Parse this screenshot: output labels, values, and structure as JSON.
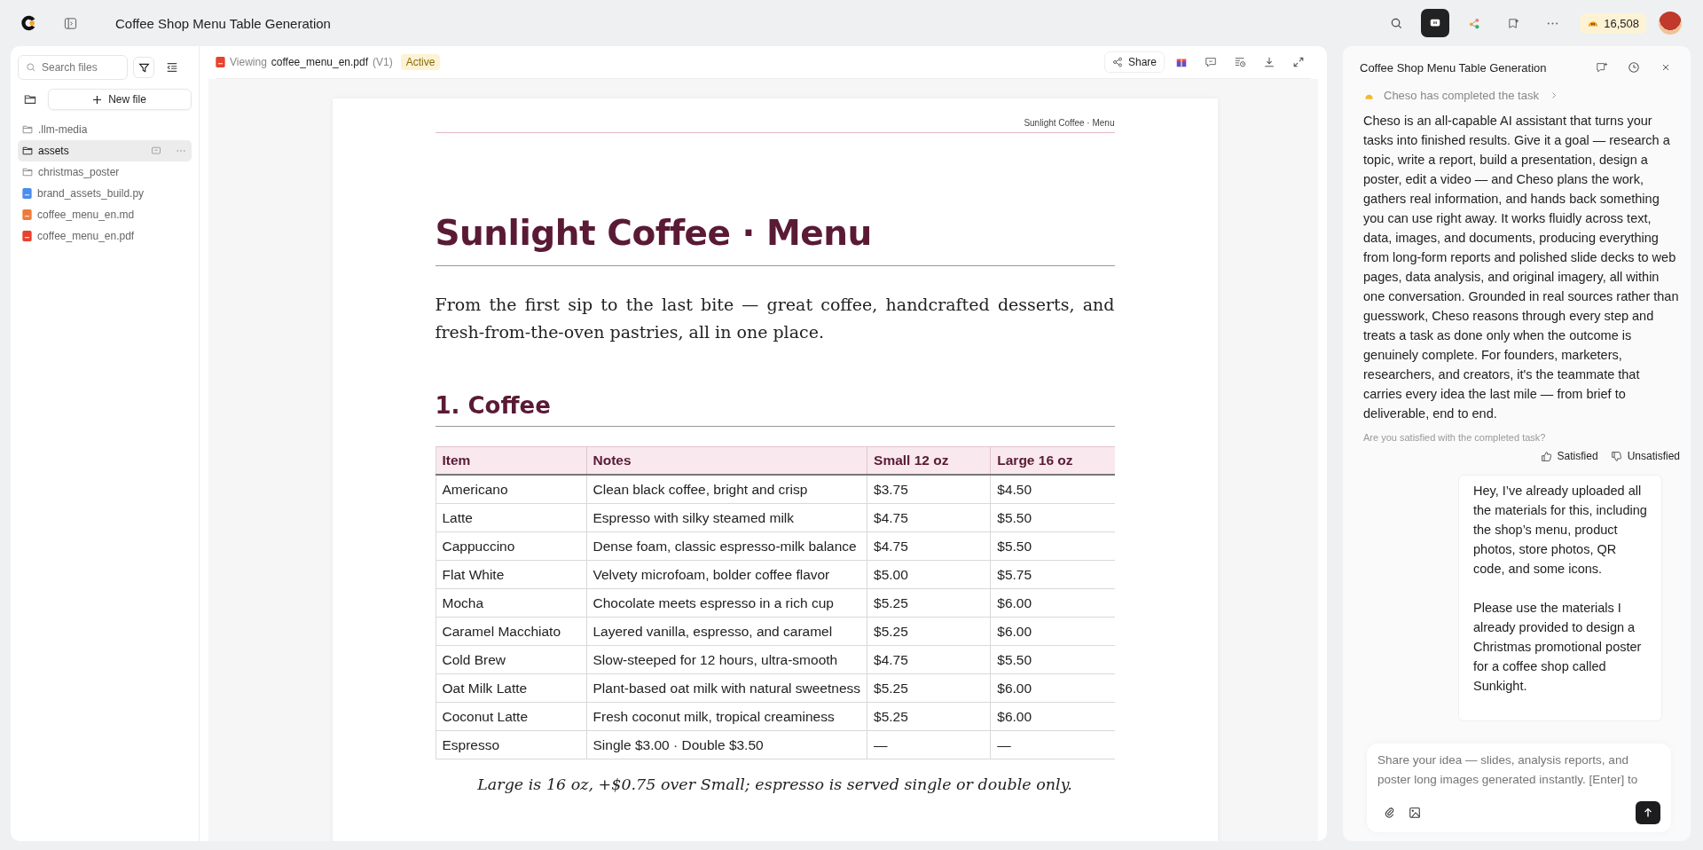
{
  "app": {
    "title": "Coffee Shop Menu Table Generation",
    "credits": "16,508"
  },
  "sidebar": {
    "search_placeholder": "Search files",
    "new_file": "New file",
    "items": [
      {
        "name": ".llm-media",
        "kind": "folder",
        "selected": false
      },
      {
        "name": "assets",
        "kind": "folder",
        "selected": true
      },
      {
        "name": "christmas_poster",
        "kind": "folder",
        "selected": false
      },
      {
        "name": "brand_assets_build.py",
        "kind": "py",
        "selected": false
      },
      {
        "name": "coffee_menu_en.md",
        "kind": "md",
        "selected": false
      },
      {
        "name": "coffee_menu_en.pdf",
        "kind": "pdf",
        "selected": false
      }
    ]
  },
  "viewer": {
    "prefix": "Viewing",
    "file": "coffee_menu_en.pdf",
    "version": "(V1)",
    "status": "Active",
    "share": "Share"
  },
  "document": {
    "running_header": "Sunlight Coffee · Menu",
    "title": "Sunlight Coffee · Menu",
    "intro": "From the first sip to the last bite — great coffee, handcrafted desserts, and fresh-from-the-oven pastries, all in one place.",
    "section": "1. Coffee",
    "columns": [
      "Item",
      "Notes",
      "Small 12 oz",
      "Large 16 oz"
    ],
    "rows": [
      [
        "Americano",
        "Clean black coffee, bright and crisp",
        "$3.75",
        "$4.50"
      ],
      [
        "Latte",
        "Espresso with silky steamed milk",
        "$4.75",
        "$5.50"
      ],
      [
        "Cappuccino",
        "Dense foam, classic espresso-milk balance",
        "$4.75",
        "$5.50"
      ],
      [
        "Flat White",
        "Velvety microfoam, bolder coffee flavor",
        "$5.00",
        "$5.75"
      ],
      [
        "Mocha",
        "Chocolate meets espresso in a rich cup",
        "$5.25",
        "$6.00"
      ],
      [
        "Caramel Macchiato",
        "Layered vanilla, espresso, and caramel",
        "$5.25",
        "$6.00"
      ],
      [
        "Cold Brew",
        "Slow-steeped for 12 hours, ultra-smooth",
        "$4.75",
        "$5.50"
      ],
      [
        "Oat Milk Latte",
        "Plant-based oat milk with natural sweetness",
        "$5.25",
        "$6.00"
      ],
      [
        "Coconut Latte",
        "Fresh coconut milk, tropical creaminess",
        "$5.25",
        "$6.00"
      ],
      [
        "Espresso",
        "Single $3.00 · Double $3.50",
        "—",
        "—"
      ]
    ],
    "footnote": "Large is 16 oz, +$0.75 over Small; espresso is served single or double only."
  },
  "chat": {
    "title": "Coffee Shop Menu Table Generation",
    "status": "Cheso has completed the task",
    "reply": "Cheso is an all-capable AI assistant that turns your tasks into finished results. Give it a goal — research a topic, write a report, build a presentation, design a poster, edit a video — and Cheso plans the work, gathers real information, and hands back something you can use right away. It works fluidly across text, data, images, and documents, producing everything from long-form reports and polished slide decks to web pages, data analysis, and original imagery, all within one conversation. Grounded in real sources rather than guesswork, Cheso reasons through every step and treats a task as done only when the outcome is genuinely complete. For founders, marketers, researchers, and creators, it's the teammate that carries every idea the last mile — from brief to deliverable, end to end.",
    "feedback_question": "Are you satisfied with the completed task?",
    "satisfied": "Satisfied",
    "unsatisfied": "Unsatisfied",
    "user_message": [
      "Hey, I’ve already uploaded all the materials for this, including the shop’s menu, product photos, store photos, QR code, and some icons.",
      "Please use the materials I already provided to design a Christmas promotional poster for a coffee shop called Sunkight."
    ],
    "input_placeholder": "Share your idea — slides, analysis reports, and poster long images generated instantly. [Enter] to"
  }
}
